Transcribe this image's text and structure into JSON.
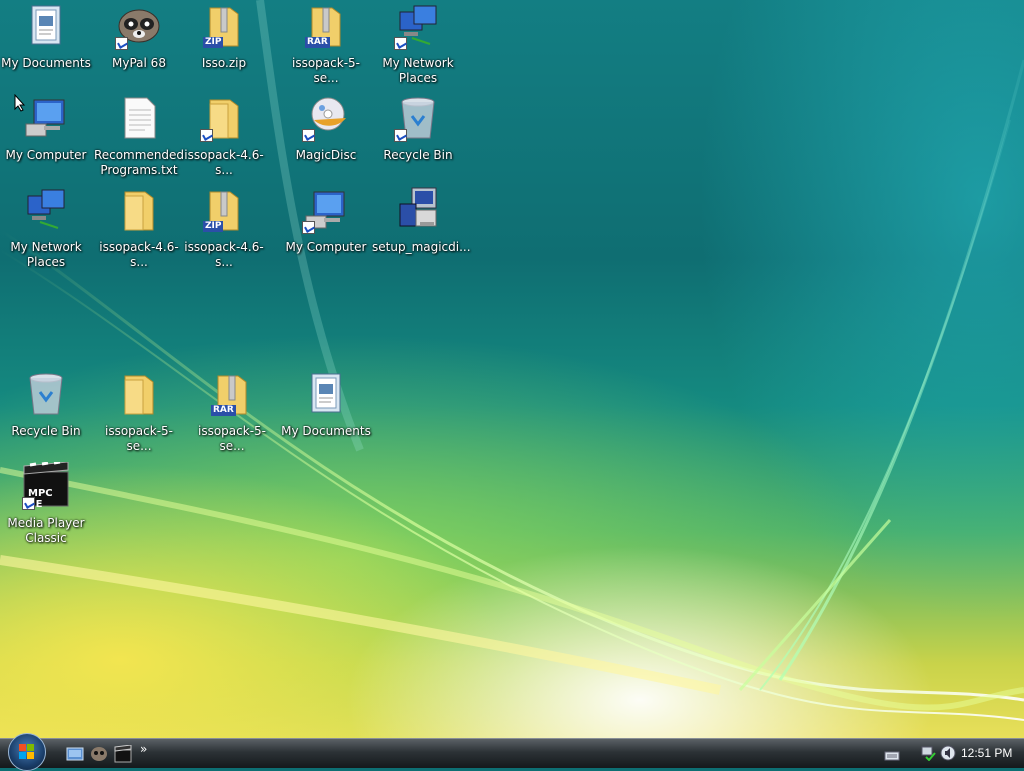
{
  "desktop": {
    "icons": [
      {
        "label": "My Documents",
        "icon": "my-documents-icon"
      },
      {
        "label": "MyPal 68",
        "icon": "mypal-icon"
      },
      {
        "label": "Isso.zip",
        "icon": "zip-folder-icon"
      },
      {
        "label": "issopack-5-se...",
        "icon": "rar-archive-icon"
      },
      {
        "label": "My Network Places",
        "icon": "network-places-icon"
      },
      {
        "label": "My Computer",
        "icon": "computer-icon"
      },
      {
        "label": "Recommended Programs.txt",
        "icon": "text-file-icon"
      },
      {
        "label": "issopack-4.6-s...",
        "icon": "folder-shortcut-icon"
      },
      {
        "label": "MagicDisc",
        "icon": "magicdisc-icon"
      },
      {
        "label": "Recycle Bin",
        "icon": "recycle-bin-icon"
      },
      {
        "label": "My Network Places",
        "icon": "network-places-icon"
      },
      {
        "label": "issopack-4.6-s...",
        "icon": "folder-icon"
      },
      {
        "label": "issopack-4.6-s...",
        "icon": "zip-folder-icon"
      },
      {
        "label": "My Computer",
        "icon": "computer-icon"
      },
      {
        "label": "setup_magicdi...",
        "icon": "installer-icon"
      },
      {
        "label": "Recycle Bin",
        "icon": "recycle-bin-icon"
      },
      {
        "label": "issopack-5-se...",
        "icon": "folder-icon"
      },
      {
        "label": "issopack-5-se...",
        "icon": "rar-archive-icon"
      },
      {
        "label": "My Documents",
        "icon": "my-documents-icon"
      },
      {
        "label": "Media Player Classic",
        "icon": "media-player-classic-icon"
      }
    ],
    "badges": {
      "zip": "ZIP",
      "rar": "RAR",
      "mpc": "MPC BE"
    }
  },
  "taskbar": {
    "clock": "12:51 PM",
    "chevron": "»"
  },
  "colors": {
    "folder": "#f1cf6a",
    "taskbar": "#2c3236",
    "wallpaper_teal": "#0f6e72",
    "wallpaper_yellow": "#e8df5a"
  }
}
